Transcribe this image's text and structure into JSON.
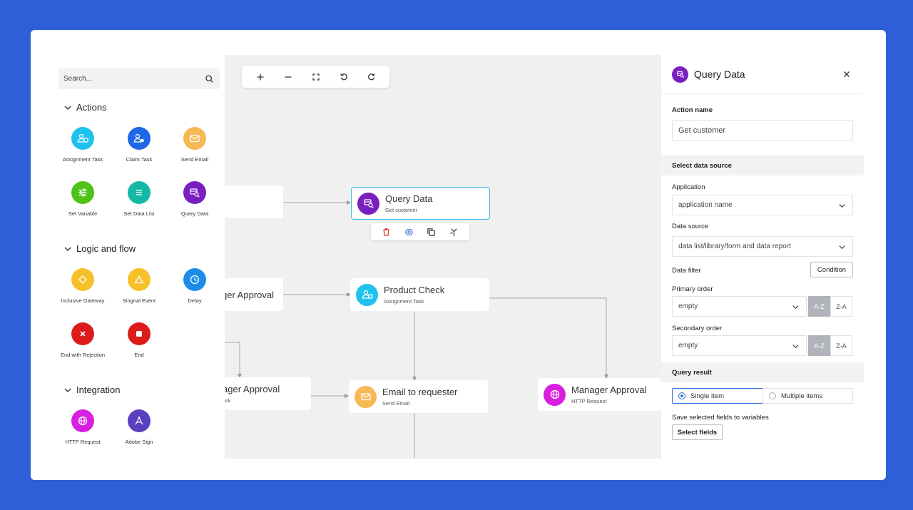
{
  "palette": {
    "search_placeholder": "Search...",
    "sections": [
      {
        "title": "Actions",
        "items": [
          {
            "label": "Assignment Task",
            "icon": "assignment-task-icon",
            "color": "#1fc2ef"
          },
          {
            "label": "Claim Task",
            "icon": "claim-task-icon",
            "color": "#1d67e8"
          },
          {
            "label": "Send Email",
            "icon": "mail-icon",
            "color": "#f7b955"
          },
          {
            "label": "Set Variable",
            "icon": "sliders-icon",
            "color": "#4fc217"
          },
          {
            "label": "Set Data List",
            "icon": "list-icon",
            "color": "#15b8a6"
          },
          {
            "label": "Query Data",
            "icon": "query-data-icon",
            "color": "#7a1fbf"
          }
        ]
      },
      {
        "title": "Logic and flow",
        "items": [
          {
            "label": "Inclusive Gateway",
            "icon": "diamond-icon",
            "color": "#f6c02b"
          },
          {
            "label": "Singnal Event",
            "icon": "triangle-icon",
            "color": "#f6c02b"
          },
          {
            "label": "Delay",
            "icon": "clock-icon",
            "color": "#1d8ce8"
          },
          {
            "label": "End with Rejection",
            "icon": "x-icon",
            "color": "#dc1b1b"
          },
          {
            "label": "End",
            "icon": "stop-icon",
            "color": "#dc1b1b"
          }
        ]
      },
      {
        "title": "Integration",
        "items": [
          {
            "label": "HTTP Request",
            "icon": "globe-icon",
            "color": "#d91ee0"
          },
          {
            "label": "Adobe Sign",
            "icon": "adobe-sign-icon",
            "color": "#5a3fc0"
          }
        ]
      }
    ]
  },
  "canvas": {
    "nodes": {
      "query_data": {
        "title": "Query Data",
        "subtitle": "Get customer",
        "color": "#7a1fbf"
      },
      "product_check": {
        "title": "Product Check",
        "subtitle": "Assignment Task",
        "color": "#1fc2ef"
      },
      "email_requester": {
        "title": "Email to requester",
        "subtitle": "Send Email",
        "color": "#f7b955"
      },
      "manager_http": {
        "title": "Manager Approval",
        "subtitle": "HTTP Request",
        "color": "#d91ee0"
      },
      "partial_1": {
        "title": "ger Approval"
      },
      "partial_2": {
        "title": "ager Approval",
        "subtitle": "ask"
      }
    }
  },
  "panel": {
    "title": "Query Data",
    "action_name_label": "Action name",
    "action_name_value": "Get customer",
    "data_source_section": "Select data source",
    "application_label": "Application",
    "application_value": "application name",
    "data_source_label": "Data source",
    "data_source_value": "data list/library/form and data report",
    "data_filter_label": "Data filter",
    "condition_button": "Condition",
    "primary_order_label": "Primary order",
    "primary_order_value": "empty",
    "secondary_order_label": "Secondary order",
    "secondary_order_value": "empty",
    "sort_asc": "A-Z",
    "sort_desc": "Z-A",
    "query_result_section": "Query result",
    "single_item": "Single item",
    "multiple_items": "Multiple items",
    "save_fields_label": "Save selected fields to variables",
    "select_fields_button": "Select fields"
  },
  "colors": {
    "background": "#2f5fd8",
    "selected_border": "#38b8ea",
    "accent": "#2f6fe0"
  }
}
